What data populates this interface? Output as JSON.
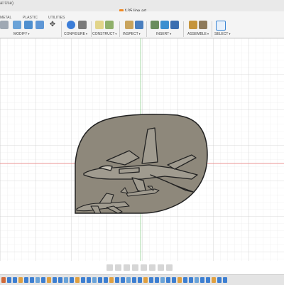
{
  "window": {
    "title_fragment": "al Use)"
  },
  "document": {
    "tab_title": "f-35 line art"
  },
  "ribbon": {
    "tabs": [
      "METAL",
      "PLASTIC",
      "UTILITIES"
    ],
    "groups": [
      {
        "label": "MODIFY"
      },
      {
        "label": "CONFIGURE"
      },
      {
        "label": "CONSTRUCT"
      },
      {
        "label": "INSPECT"
      },
      {
        "label": "INSERT"
      },
      {
        "label": "ASSEMBLE"
      },
      {
        "label": "SELECT"
      }
    ]
  },
  "colors": {
    "ribbon_bg": "#f4f4f4",
    "canvas_bg": "#ffffff",
    "grid_minor": "#e6e6e6",
    "grid_major": "#cccccc",
    "axis_red": "#e57373",
    "axis_green": "#66bb6a",
    "body_fill": "#8e887b",
    "line_art": "#222222"
  },
  "icons": {
    "ribbon": [
      "shell-icon",
      "box-icon",
      "combine-icon",
      "move-icon",
      "parameters-icon",
      "plane-icon",
      "midplane-icon",
      "measure-icon",
      "section-icon",
      "insert-image-icon",
      "insert-mesh-icon",
      "insert-svg-icon",
      "joint-icon",
      "select-icon"
    ],
    "navbar": [
      "orbit-icon",
      "pan-icon",
      "zoom-icon",
      "fit-icon",
      "display-settings-icon",
      "grid-settings-icon",
      "viewports-icon"
    ]
  }
}
